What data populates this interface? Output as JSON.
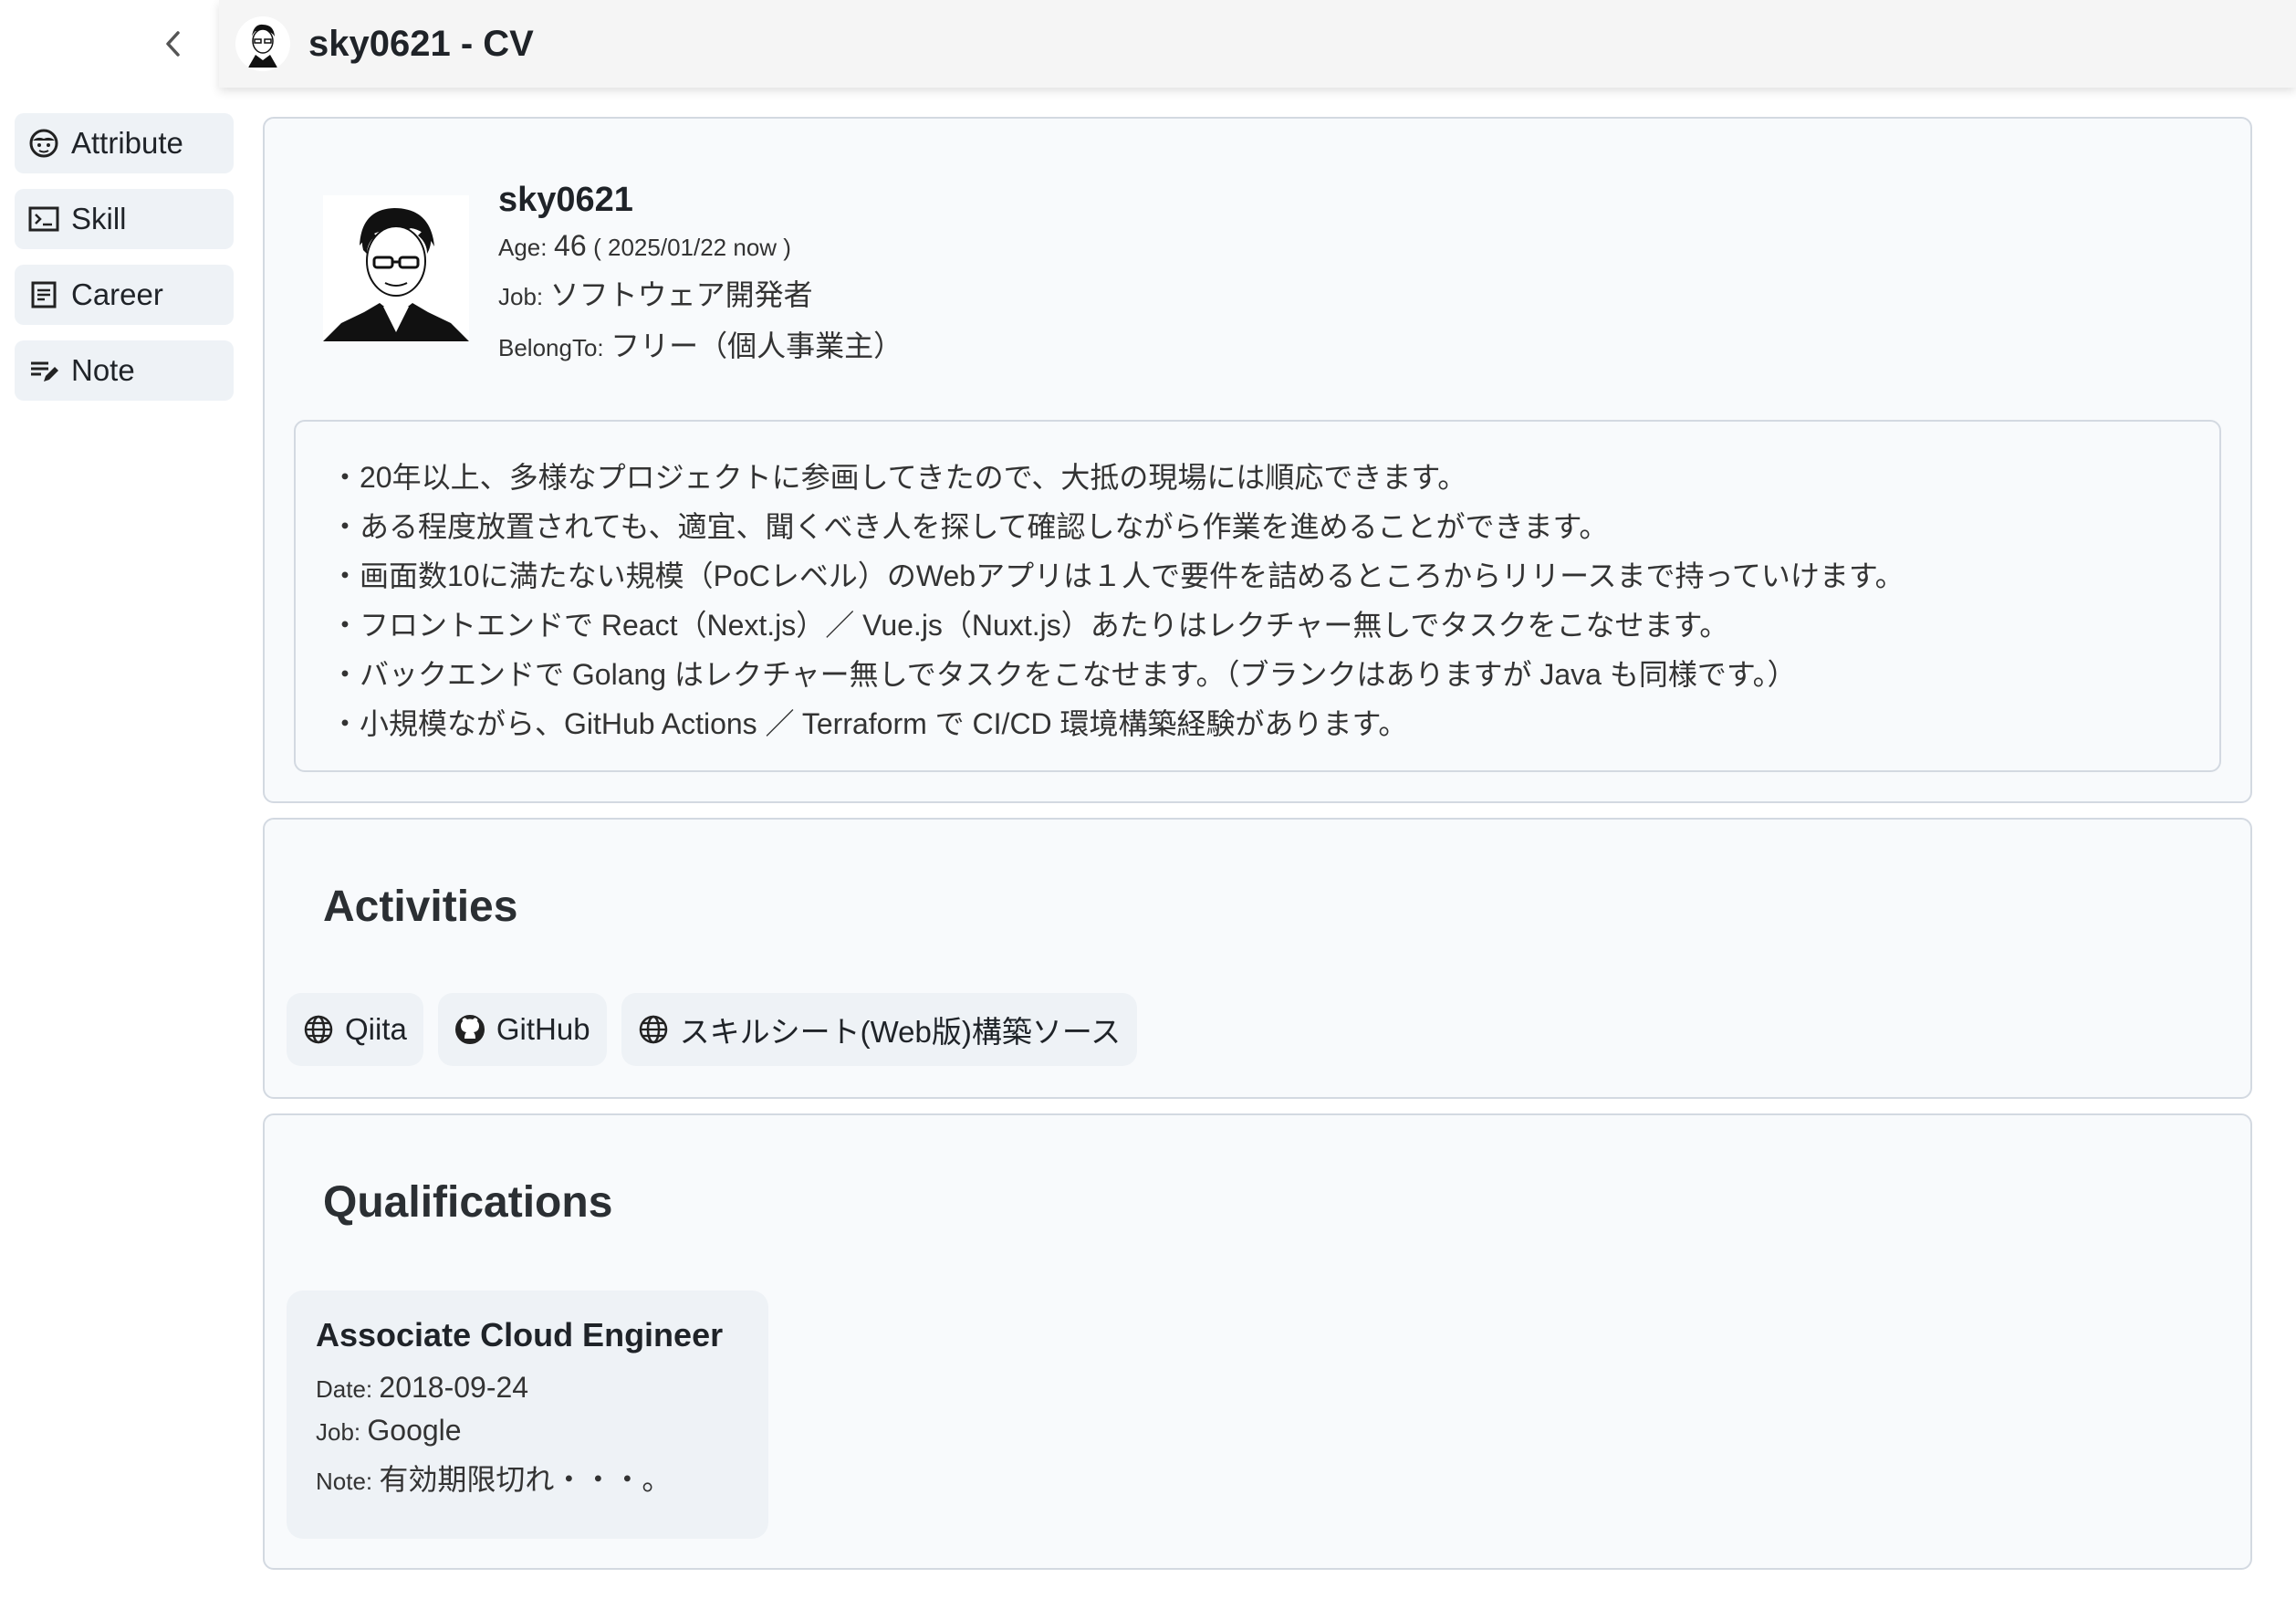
{
  "header": {
    "title": "sky0621 - CV"
  },
  "sidebar": {
    "items": [
      {
        "label": "Attribute",
        "icon": "face-icon"
      },
      {
        "label": "Skill",
        "icon": "terminal-icon"
      },
      {
        "label": "Career",
        "icon": "document-icon"
      },
      {
        "label": "Note",
        "icon": "edit-note-icon"
      }
    ]
  },
  "profile": {
    "name": "sky0621",
    "age_label": "Age:",
    "age_value": "46",
    "age_note": "( 2025/01/22 now )",
    "job_label": "Job:",
    "job_value": "ソフトウェア開発者",
    "belong_label": "BelongTo:",
    "belong_value": "フリー（個人事業主）",
    "summary": [
      "・20年以上、多様なプロジェクトに参画してきたので、大抵の現場には順応できます。",
      "・ある程度放置されても、適宜、聞くべき人を探して確認しながら作業を進めることができます。",
      "・画面数10に満たない規模（PoCレベル）のWebアプリは１人で要件を詰めるところからリリースまで持っていけます。",
      "・フロントエンドで React（Next.js）／ Vue.js（Nuxt.js）あたりはレクチャー無しでタスクをこなせます。",
      "・バックエンドで Golang はレクチャー無しでタスクをこなせます。（ブランクはありますが Java も同様です。）",
      "・小規模ながら、GitHub Actions ／ Terraform で CI/CD 環境構築経験があります。"
    ]
  },
  "activities": {
    "title": "Activities",
    "links": [
      {
        "label": "Qiita",
        "icon": "globe-icon"
      },
      {
        "label": "GitHub",
        "icon": "github-icon"
      },
      {
        "label": "スキルシート(Web版)構築ソース",
        "icon": "globe-icon"
      }
    ]
  },
  "qualifications": {
    "title": "Qualifications",
    "items": [
      {
        "name": "Associate Cloud Engineer",
        "date_label": "Date:",
        "date_value": "2018-09-24",
        "job_label": "Job:",
        "job_value": "Google",
        "note_label": "Note:",
        "note_value": "有効期限切れ・・・。"
      }
    ]
  }
}
